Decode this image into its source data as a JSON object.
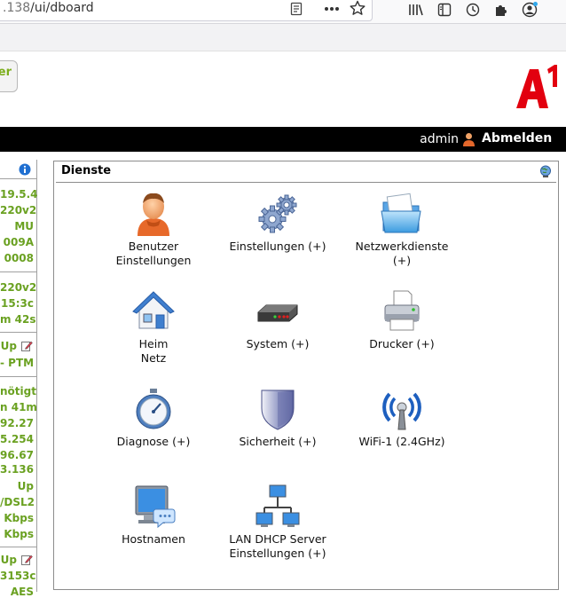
{
  "browser": {
    "url_dim": ".138",
    "url_main": "/ui/dboard"
  },
  "header": {
    "left_button_label": "er",
    "logo_alt": "A1"
  },
  "topbar": {
    "username": "admin",
    "logout_label": "Abmelden"
  },
  "status_column": {
    "rows": [
      "19.5.4",
      "220v2",
      "MU",
      "009A",
      "0008",
      "220v2",
      "15:3c",
      "m 42s",
      "Up",
      "- PTM",
      "nötigt",
      "n 41m",
      "92.27",
      "5.254",
      "96.67",
      "3.136",
      "Up",
      "/DSL2",
      "Kbps",
      "Kbps",
      "Up",
      "3153c",
      "AES"
    ]
  },
  "panel": {
    "title": "Dienste",
    "tiles": [
      {
        "label": "Benutzer\nEinstellungen",
        "icon": "user-icon"
      },
      {
        "label": "Einstellungen (+)",
        "icon": "gears-icon"
      },
      {
        "label": "Netzwerkdienste\n(+)",
        "icon": "folder-icon"
      },
      {
        "label": "Heim\nNetz",
        "icon": "house-icon"
      },
      {
        "label": "System (+)",
        "icon": "router-icon"
      },
      {
        "label": "Drucker (+)",
        "icon": "printer-icon"
      },
      {
        "label": "Diagnose (+)",
        "icon": "stopwatch-icon"
      },
      {
        "label": "Sicherheit (+)",
        "icon": "shield-icon"
      },
      {
        "label": "WiFi-1 (2.4GHz)",
        "icon": "antenna-icon"
      },
      {
        "label": "Hostnamen",
        "icon": "monitor-icon"
      },
      {
        "label": "LAN DHCP Server\nEinstellungen (+)",
        "icon": "network-icon"
      }
    ]
  },
  "colors": {
    "accent_green": "#6aa121",
    "brand_red": "#e2000f",
    "topbar": "#000000"
  }
}
